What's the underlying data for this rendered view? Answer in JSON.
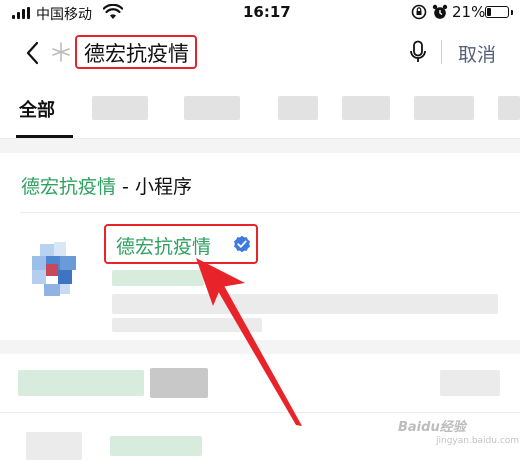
{
  "status_bar": {
    "carrier": "中国移动",
    "time": "16:17",
    "battery_percent": "21%",
    "battery_level": 0.21
  },
  "search": {
    "query_icon": "sparkle-icon",
    "query": "德宏抗疫情",
    "cancel_label": "取消"
  },
  "tabs": {
    "active_label": "全部"
  },
  "section": {
    "keyword": "德宏抗疫情",
    "suffix": " - 小程序"
  },
  "result": {
    "title": "德宏抗疫情",
    "badge_icon": "verified-icon"
  },
  "annotation": {
    "highlight_color": "#e8232a"
  },
  "watermark": {
    "text": "Baidu经验",
    "sub": "jingyan.baidu.com"
  },
  "colors": {
    "keyword_green": "#2ea160",
    "cancel_link": "#55607a",
    "verified_blue": "#3d7be0"
  }
}
